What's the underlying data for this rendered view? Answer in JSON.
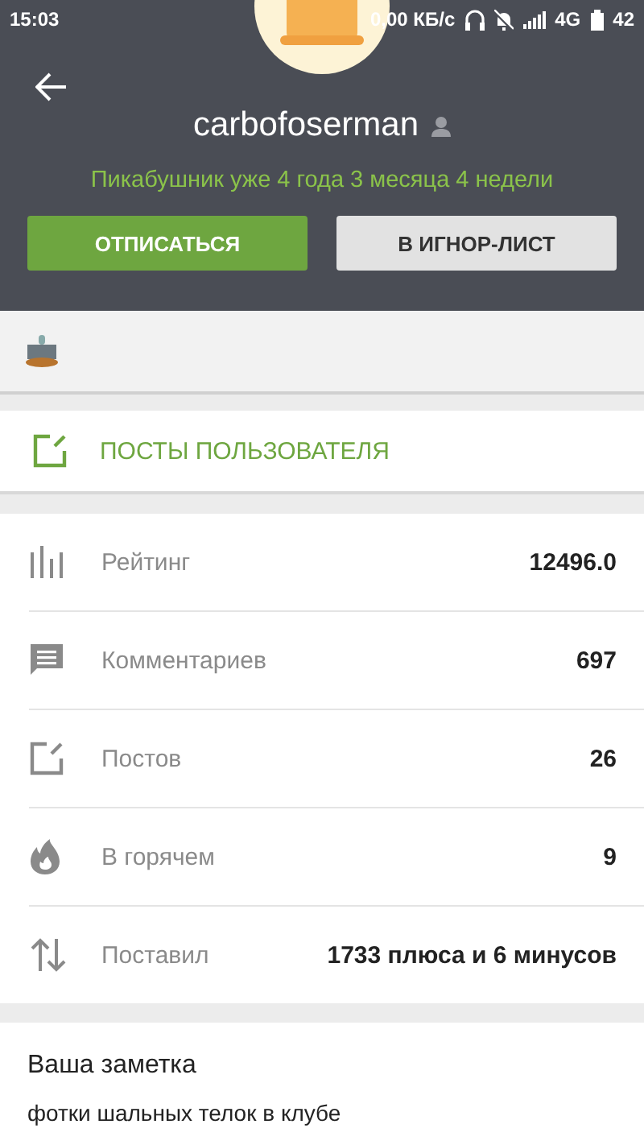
{
  "status_bar": {
    "time": "15:03",
    "speed": "0,00 КБ/с",
    "network": "4G",
    "battery": "42"
  },
  "profile": {
    "username": "carbofoserman",
    "tenure": "Пикабушник уже 4 года 3 месяца 4 недели"
  },
  "buttons": [
    {
      "label": "ОТПИСАТЬСЯ",
      "kind": "primary"
    },
    {
      "label": "В ИГНОР-ЛИСТ",
      "kind": "secondary"
    }
  ],
  "posts_link": "ПОСТЫ ПОЛЬЗОВАТЕЛЯ",
  "stats": [
    {
      "kind": "rating",
      "label": "Рейтинг",
      "value": "12496.0"
    },
    {
      "kind": "comments",
      "label": "Комментариев",
      "value": "697"
    },
    {
      "kind": "posts",
      "label": "Постов",
      "value": "26"
    },
    {
      "kind": "hot",
      "label": "В горячем",
      "value": "9"
    },
    {
      "kind": "votes",
      "label": "Поставил",
      "value": "1733 плюса и 6 минусов"
    }
  ],
  "note": {
    "title": "Ваша заметка",
    "text": "фотки шальных телок в клубе"
  }
}
